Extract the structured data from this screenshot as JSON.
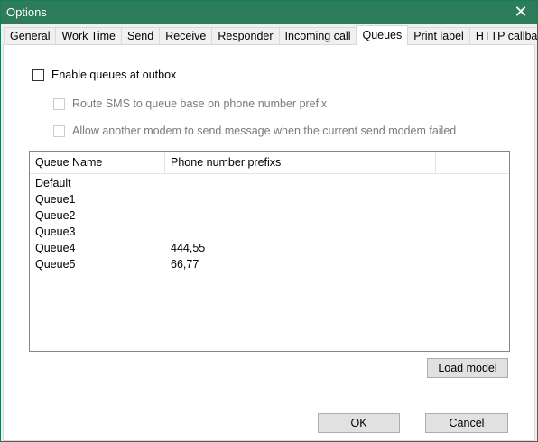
{
  "window": {
    "title": "Options"
  },
  "tabs": [
    {
      "label": "General"
    },
    {
      "label": "Work Time"
    },
    {
      "label": "Send"
    },
    {
      "label": "Receive"
    },
    {
      "label": "Responder"
    },
    {
      "label": "Incoming call"
    },
    {
      "label": "Queues",
      "active": true
    },
    {
      "label": "Print label"
    },
    {
      "label": "HTTP callbacks"
    }
  ],
  "queues": {
    "enable_label": "Enable queues at outbox",
    "route_label": "Route SMS to queue base on phone number prefix",
    "allow_label": "Allow another modem to send message when the current send modem failed",
    "columns": [
      "Queue Name",
      "Phone number prefixs"
    ],
    "rows": [
      {
        "name": "Default",
        "prefix": ""
      },
      {
        "name": "Queue1",
        "prefix": ""
      },
      {
        "name": "Queue2",
        "prefix": ""
      },
      {
        "name": "Queue3",
        "prefix": ""
      },
      {
        "name": "Queue4",
        "prefix": "444,55"
      },
      {
        "name": "Queue5",
        "prefix": "66,77"
      }
    ],
    "load_model_label": "Load model"
  },
  "buttons": {
    "ok": "OK",
    "cancel": "Cancel"
  },
  "colors": {
    "titlebar": "#2d7d5b"
  }
}
